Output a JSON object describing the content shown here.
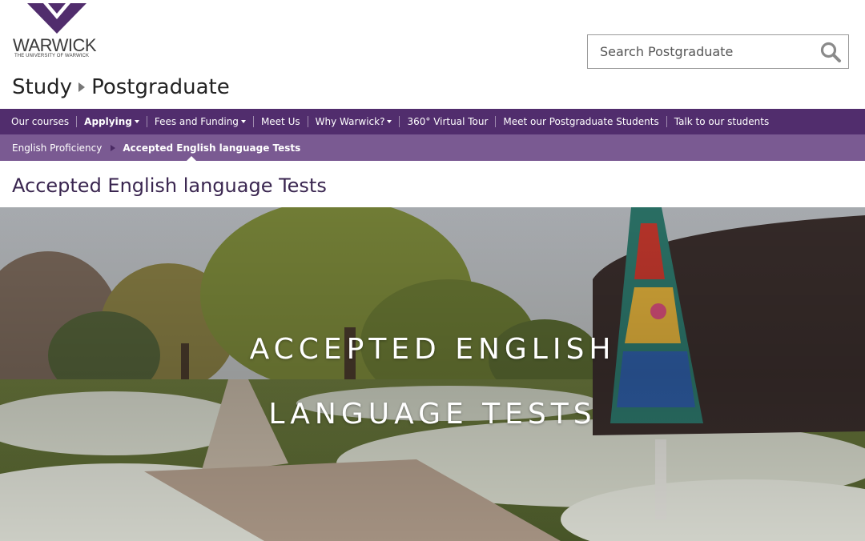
{
  "brand": {
    "name": "WARWICK",
    "subtitle": "THE UNIVERSITY OF WARWICK",
    "color": "#512d6d"
  },
  "search": {
    "placeholder": "Search Postgraduate",
    "icon": "search-icon"
  },
  "breadcrumb": {
    "root": "Study",
    "section": "Postgraduate"
  },
  "nav": {
    "background": "#512d6d",
    "items": [
      {
        "label": "Our courses",
        "dropdown": false,
        "active": false
      },
      {
        "label": "Applying",
        "dropdown": true,
        "active": true
      },
      {
        "label": "Fees and Funding",
        "dropdown": true,
        "active": false
      },
      {
        "label": "Meet Us",
        "dropdown": false,
        "active": false
      },
      {
        "label": "Why Warwick?",
        "dropdown": true,
        "active": false
      },
      {
        "label": "360° Virtual Tour",
        "dropdown": false,
        "active": false
      },
      {
        "label": "Meet our Postgraduate Students",
        "dropdown": false,
        "active": false
      },
      {
        "label": "Talk to our students",
        "dropdown": false,
        "active": false
      }
    ]
  },
  "subnav": {
    "background": "#7a5a92",
    "parent": "English Proficiency",
    "current": "Accepted English language Tests"
  },
  "page": {
    "title": "Accepted English language Tests"
  },
  "hero": {
    "line1": "ACCEPTED ENGLISH",
    "line2": "LANGUAGE TESTS"
  }
}
